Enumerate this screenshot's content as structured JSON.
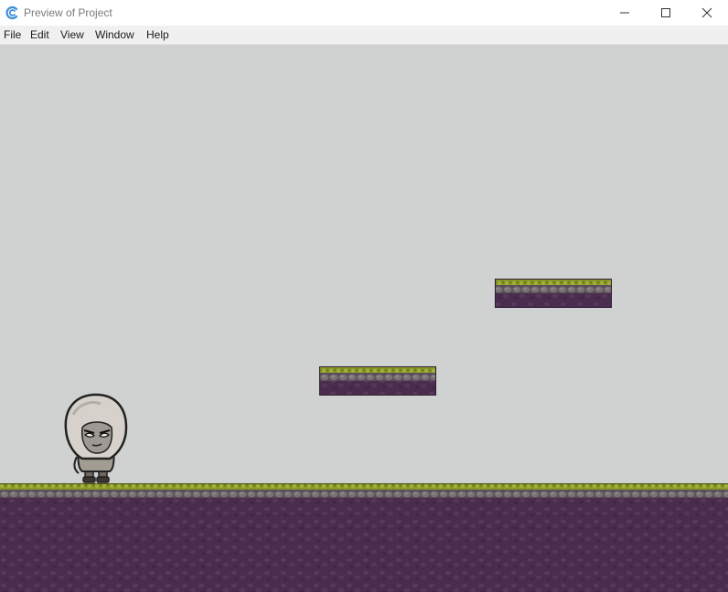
{
  "window": {
    "title": "Preview of Project",
    "app_icon": "gdevelop-logo-icon",
    "controls": [
      "minimize-icon",
      "maximize-icon",
      "close-icon"
    ]
  },
  "menu": {
    "items": [
      {
        "label": "File"
      },
      {
        "label": "Edit"
      },
      {
        "label": "View"
      },
      {
        "label": "Window"
      },
      {
        "label": "Help"
      }
    ]
  },
  "scene": {
    "background": "#d0d2d1",
    "colors": {
      "grass": "#8a9a2a",
      "grass_dark": "#5e6b1c",
      "stone": "#6e6a6a",
      "dirt": "#4a2d4e",
      "dirt_spot": "#5a3a5e"
    },
    "character": "hooded-character"
  }
}
